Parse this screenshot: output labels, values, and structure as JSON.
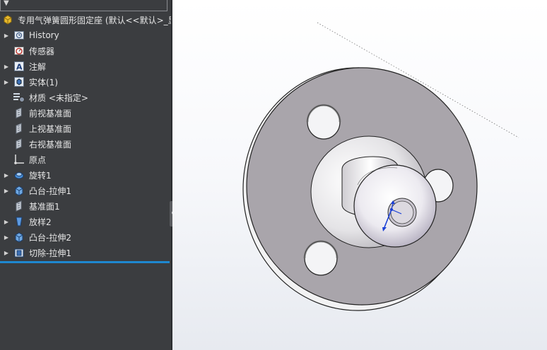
{
  "tree": {
    "root_label": "专用气弹簧圆形固定座 (默认<<默认>_显",
    "items": [
      {
        "label": "History",
        "icon": "history-icon",
        "expandable": true
      },
      {
        "label": "传感器",
        "icon": "sensor-icon",
        "expandable": false
      },
      {
        "label": "注解",
        "icon": "annotation-icon",
        "expandable": true
      },
      {
        "label": "实体(1)",
        "icon": "solid-body-icon",
        "expandable": true
      },
      {
        "label": "材质 <未指定>",
        "icon": "material-icon",
        "expandable": false
      },
      {
        "label": "前视基准面",
        "icon": "plane-icon",
        "expandable": false
      },
      {
        "label": "上视基准面",
        "icon": "plane-icon",
        "expandable": false
      },
      {
        "label": "右视基准面",
        "icon": "plane-icon",
        "expandable": false
      },
      {
        "label": "原点",
        "icon": "origin-icon",
        "expandable": false
      },
      {
        "label": "旋转1",
        "icon": "revolve-icon",
        "expandable": true
      },
      {
        "label": "凸台-拉伸1",
        "icon": "boss-extrude-icon",
        "expandable": true
      },
      {
        "label": "基准面1",
        "icon": "plane-icon",
        "expandable": false
      },
      {
        "label": "放样2",
        "icon": "loft-icon",
        "expandable": true
      },
      {
        "label": "凸台-拉伸2",
        "icon": "boss-extrude-icon",
        "expandable": true
      },
      {
        "label": "切除-拉伸1",
        "icon": "cut-extrude-icon",
        "expandable": true
      }
    ]
  },
  "colors": {
    "panel_bg": "#3b3d40",
    "selection_line": "#1e88d0",
    "flange_face": "#a9a5ab",
    "triad_blue": "#1a3fd6"
  }
}
